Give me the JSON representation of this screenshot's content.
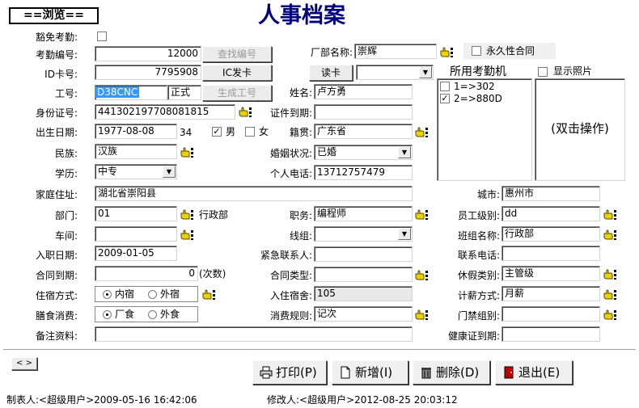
{
  "view_tab": "==浏览==",
  "title": "人事档案",
  "labels": {
    "exempt": "豁免考勤:",
    "attendance_no": "考勤编号:",
    "id_card_no": "ID卡号:",
    "emp_no": "工号:",
    "id_number": "身份证号:",
    "birth_date": "出生日期:",
    "ethnicity": "民族:",
    "education": "学历:",
    "address": "家庭住址:",
    "dept": "部门:",
    "workshop": "车间:",
    "hire_date": "入职日期:",
    "contract_expiry": "合同到期:",
    "housing": "住宿方式:",
    "meals": "膳食消费:",
    "remarks": "备注资料:",
    "factory": "厂部名称:",
    "name": "姓名:",
    "cert_expiry": "证件到期:",
    "native_place": "籍贯:",
    "marital": "婚姻状况:",
    "phone": "个人电话:",
    "city": "城市:",
    "position": "职务:",
    "line_group": "线组:",
    "emergency": "紧急联系人:",
    "contract_type": "合同类型:",
    "dorm": "入住宿舍:",
    "consume_rule": "消费规则:",
    "emp_level": "员工级别:",
    "team_name": "班组名称:",
    "contact_phone": "联系电话:",
    "leave_type": "休假类别:",
    "pay_method": "计薪方式:",
    "door_group": "门禁组别:",
    "health_expiry": "健康证到期:"
  },
  "values": {
    "attendance_no": "12000",
    "id_card_no": "7795908",
    "emp_no": "D38CNC",
    "emp_status": "正式",
    "id_number": "441302197708081815",
    "birth_date": "1977-08-08",
    "age": "34",
    "ethnicity": "汉族",
    "education": "中专",
    "address": "湖北省崇阳县",
    "dept_code": "01",
    "dept_name": "行政部",
    "workshop": "",
    "hire_date": "2009-01-05",
    "contract_count": "0",
    "contract_count_suffix": "(次数)",
    "remarks": "",
    "factory": "崇辉",
    "name": "卢方勇",
    "cert_expiry": "",
    "native_place": "广东省",
    "marital": "已婚",
    "phone": "13712757479",
    "city": "惠州市",
    "position": "编程师",
    "line_group": "",
    "emergency": "",
    "contract_type": "",
    "dorm": "105",
    "consume_rule": "记次",
    "emp_level": "dd",
    "team_name": "行政部",
    "contact_phone": "",
    "leave_type": "主管级",
    "pay_method": "月薪",
    "door_group": "",
    "health_expiry": "",
    "reader": ""
  },
  "buttons": {
    "find_no": "查找编号",
    "ic_issue": "IC发卡",
    "gen_no": "生成工号",
    "read_card": "读卡",
    "print": "打印(P)",
    "add": "新增(I)",
    "delete": "删除(D)",
    "exit": "退出(E)",
    "nav": "< >"
  },
  "checks": {
    "permanent_contract": "永久性合同",
    "show_photo": "显示照片",
    "male": "男",
    "female": "女",
    "male_checked": true,
    "female_checked": false,
    "exempt_checked": false,
    "permanent_checked": false,
    "show_photo_checked": false
  },
  "machines": {
    "header": "所用考勤机",
    "items": [
      {
        "label": "1=>302",
        "checked": false
      },
      {
        "label": "2=>880D",
        "checked": true
      }
    ]
  },
  "photo_hint": "(双击操作)",
  "radios": {
    "housing": {
      "opt1": "内宿",
      "opt2": "外宿",
      "selected": "内宿"
    },
    "meals": {
      "opt1": "厂食",
      "opt2": "外食",
      "selected": "厂食"
    }
  },
  "footer": {
    "creator": "制表人:<超级用户>2009-05-16 16:42:06",
    "modifier": "修改人:<超级用户>2012-08-25 20:03:12"
  },
  "colors": {
    "title": "#00007f",
    "selection": "#3399ff",
    "hand_icon": "#b8a400"
  }
}
